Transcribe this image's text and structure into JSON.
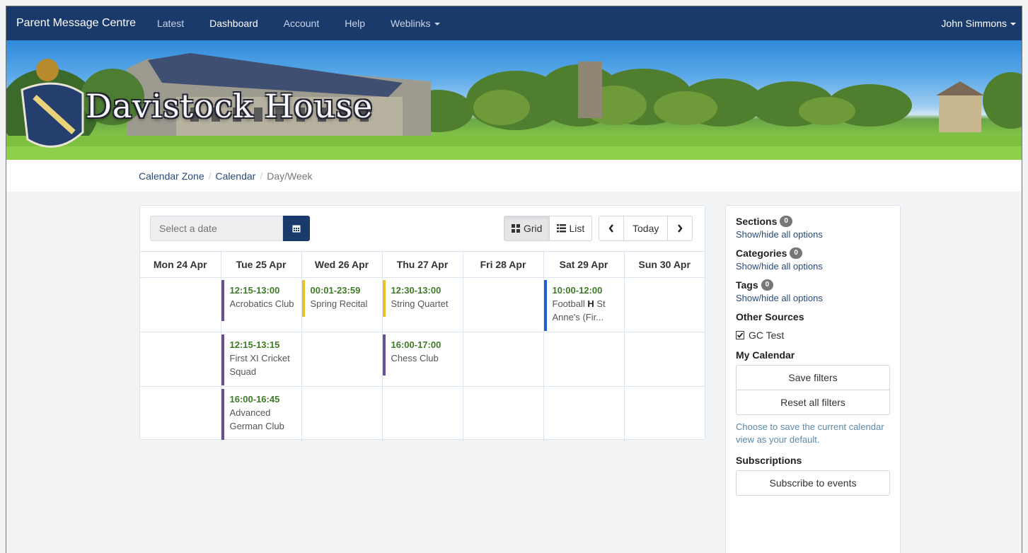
{
  "navbar": {
    "brand": "Parent Message Centre",
    "items": [
      "Latest",
      "Dashboard",
      "Account",
      "Help",
      "Weblinks"
    ],
    "user": "John Simmons",
    "bg_color": "#1a3a6b"
  },
  "banner": {
    "title": "Davistock House"
  },
  "breadcrumb": {
    "items": [
      "Calendar Zone",
      "Calendar"
    ],
    "active": "Day/Week"
  },
  "toolbar": {
    "date_placeholder": "Select a date",
    "grid_label": "Grid",
    "list_label": "List",
    "today_label": "Today"
  },
  "calendar": {
    "days": [
      "Mon 24 Apr",
      "Tue 25 Apr",
      "Wed 26 Apr",
      "Thu 27 Apr",
      "Fri 28 Apr",
      "Sat 29 Apr",
      "Sun 30 Apr"
    ],
    "events": {
      "tue_1": {
        "time": "12:15-13:00",
        "title": "Acrobatics Club",
        "color": "#6b4f8e"
      },
      "tue_2": {
        "time": "12:15-13:15",
        "title": "First XI Cricket Squad",
        "color": "#6b4f8e"
      },
      "tue_3": {
        "time": "16:00-16:45",
        "title": "Advanced German Club",
        "color": "#6b4f8e"
      },
      "wed_1": {
        "time": "00:01-23:59",
        "title": "Spring Recital",
        "color": "#e8c02a"
      },
      "thu_1": {
        "time": "12:30-13:00",
        "title": "String Quartet",
        "color": "#e8c02a"
      },
      "thu_2": {
        "time": "16:00-17:00",
        "title": "Chess Club",
        "color": "#6b4f8e"
      },
      "sat_1": {
        "time": "10:00-12:00",
        "title_pre": "Football ",
        "title_bold": "H",
        "title_post": " St Anne's (Fir...",
        "color": "#1f5ccc"
      }
    }
  },
  "sidebar": {
    "sections": {
      "label": "Sections",
      "count": "0",
      "link": "Show/hide all options"
    },
    "categories": {
      "label": "Categories",
      "count": "0",
      "link": "Show/hide all options"
    },
    "tags": {
      "label": "Tags",
      "count": "0",
      "link": "Show/hide all options"
    },
    "other_sources": {
      "label": "Other Sources",
      "item": "GC Test",
      "checked": true
    },
    "my_calendar": {
      "label": "My Calendar",
      "save": "Save filters",
      "reset": "Reset all filters",
      "help": "Choose to save the current calendar view as your default."
    },
    "subscriptions": {
      "label": "Subscriptions",
      "button": "Subscribe to events"
    }
  }
}
